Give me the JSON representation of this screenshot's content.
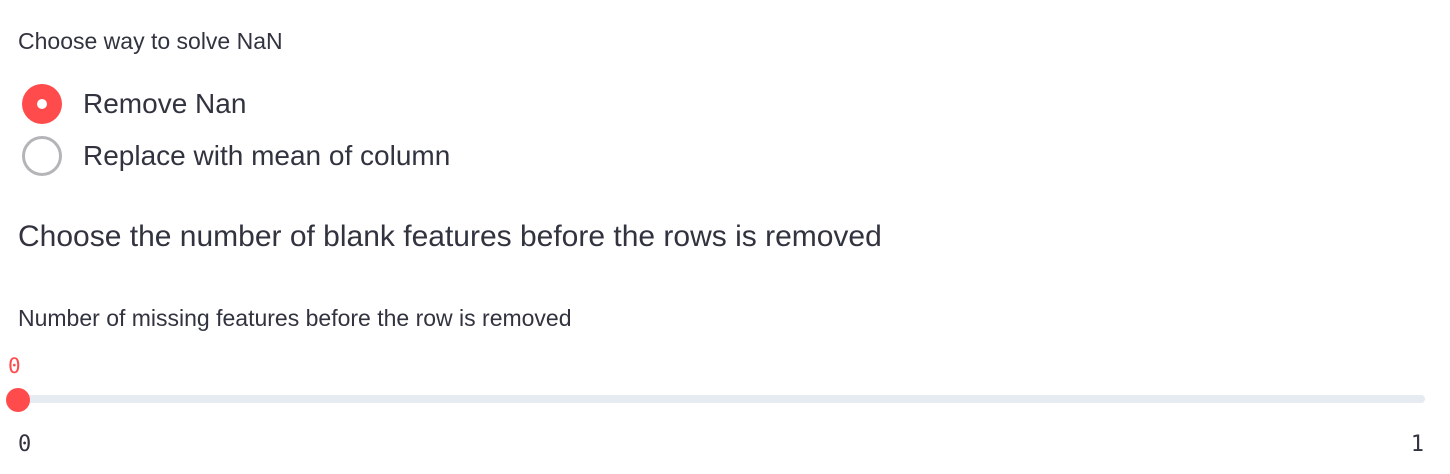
{
  "nan_radio": {
    "label": "Choose way to solve NaN",
    "options": [
      {
        "label": "Remove Nan",
        "selected": true
      },
      {
        "label": "Replace with mean of column",
        "selected": false
      }
    ]
  },
  "heading": "Choose the number of blank features before the rows is removed",
  "slider": {
    "label": "Number of missing features before the row is removed",
    "value": "0",
    "min": "0",
    "max": "1",
    "fraction": 0
  },
  "colors": {
    "accent": "#ff4b4b",
    "text": "#31333f",
    "track": "#e6eaf1",
    "radio_border": "#b5b5b9"
  }
}
